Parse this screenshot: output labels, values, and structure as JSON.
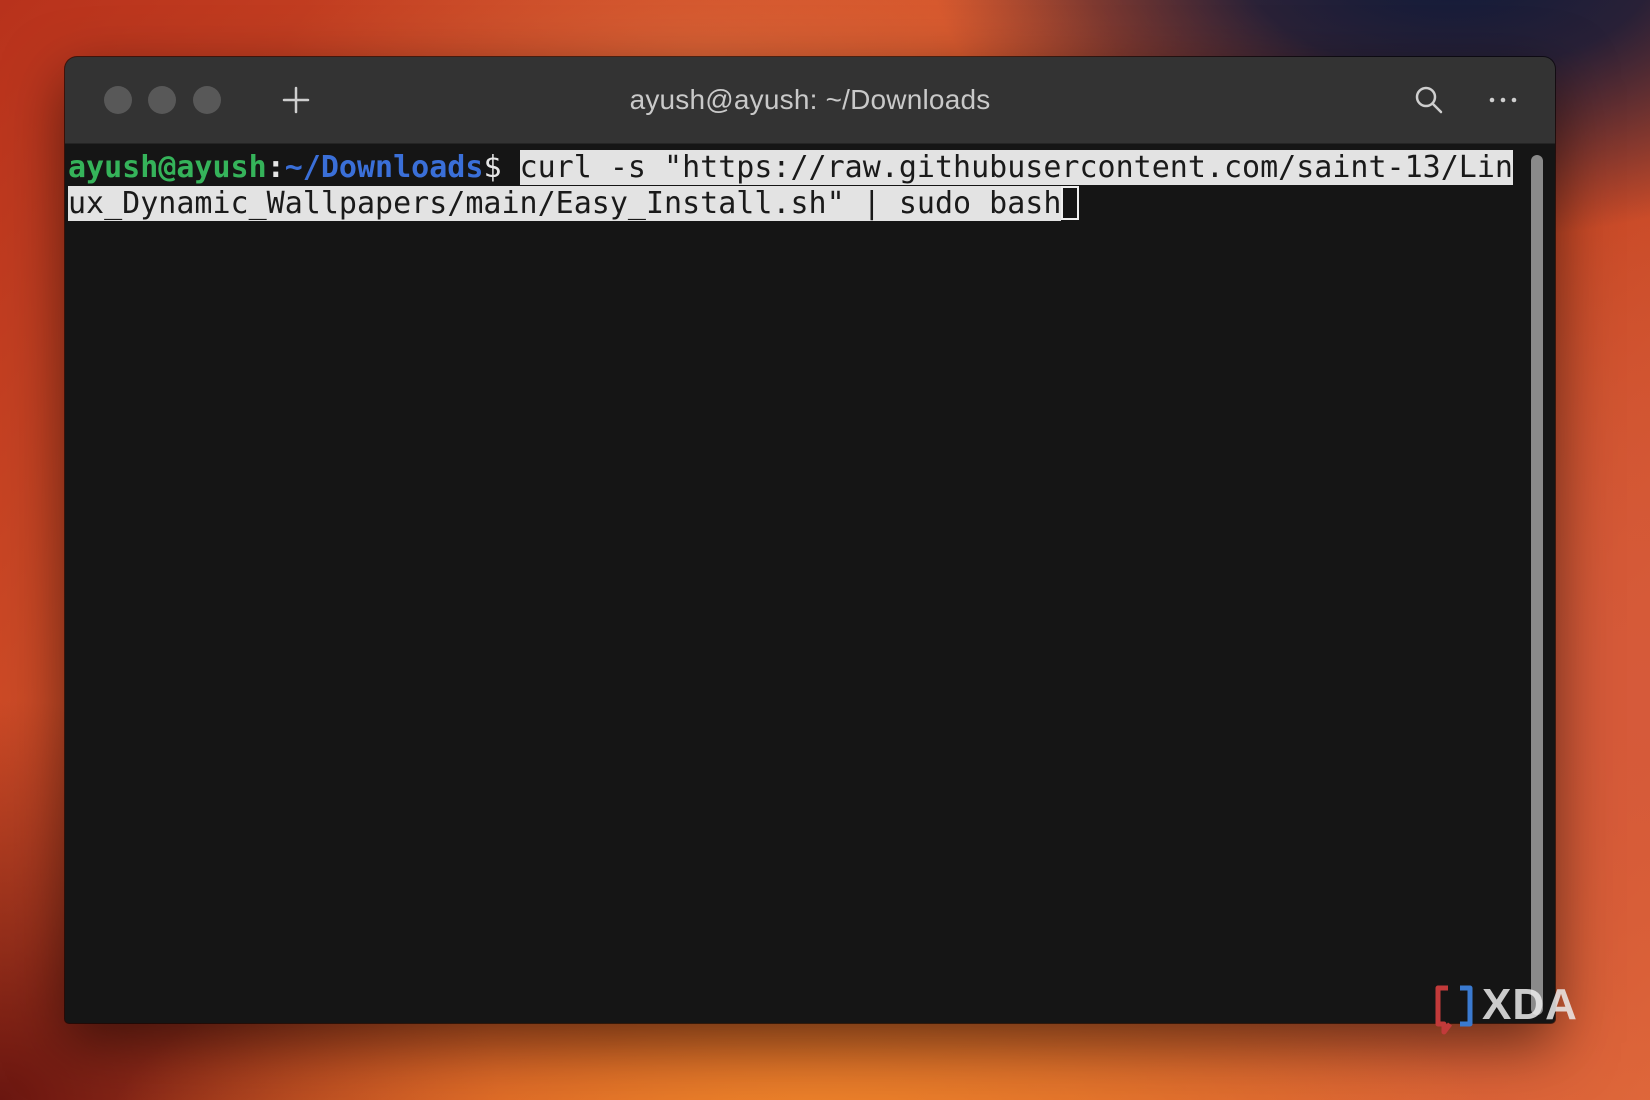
{
  "window": {
    "title": "ayush@ayush: ~/Downloads"
  },
  "titlebar": {
    "buttons": {
      "close_icon": "traffic-light-close",
      "minimize_icon": "traffic-light-minimize",
      "maximize_icon": "traffic-light-maximize",
      "new_tab_icon": "plus-icon",
      "search_icon": "search-icon",
      "menu_icon": "ellipsis-icon"
    }
  },
  "terminal": {
    "prompt": {
      "user_host": "ayush@ayush",
      "colon": ":",
      "path": "~/Downloads",
      "symbol": "$ "
    },
    "command_line1": "curl -s \"https://raw.githubusercontent.com/saint-13/Lin",
    "command_line2": "ux_Dynamic_Wallpapers/main/Easy_Install.sh\" | sudo bash",
    "colors": {
      "background": "#151515",
      "user_host": "#35b35a",
      "path": "#3a6fd8",
      "selection": "#e3e3e3"
    }
  },
  "watermark": {
    "text": "XDA"
  }
}
